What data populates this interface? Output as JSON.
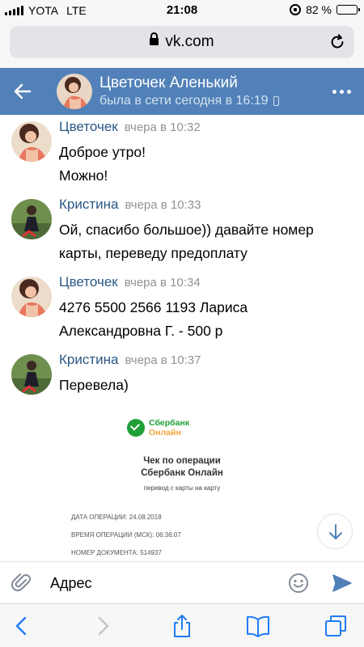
{
  "status_bar": {
    "carrier": "YOTA",
    "network": "LTE",
    "time": "21:08",
    "battery_percent": "82 %",
    "battery_level": 0.82
  },
  "browser": {
    "url": "vk.com"
  },
  "header": {
    "name": "Цветочек Аленький",
    "status": "была в сети сегодня в 16:19"
  },
  "messages": [
    {
      "author": "Цветочек",
      "time": "вчера в 10:32",
      "lines": [
        "Доброе утро!",
        "Можно!"
      ]
    },
    {
      "author": "Кристина",
      "time": "вчера в 10:33",
      "lines": [
        "Ой, спасибо большое)) давайте номер",
        "карты, переведу предоплату"
      ]
    },
    {
      "author": "Цветочек",
      "time": "вчера в 10:34",
      "lines": [
        "4276 5500 2566 1193 Лариса",
        "Александровна Г. - 500 р"
      ]
    },
    {
      "author": "Кристина",
      "time": "вчера в 10:37",
      "lines": [
        "Перевела)"
      ]
    }
  ],
  "receipt": {
    "logo_line1": "Сбербанк",
    "logo_line2": "Онлайн",
    "title_line1": "Чек по операции",
    "title_line2": "Сбербанк Онлайн",
    "subtitle": "перевод с карты на карту",
    "rows": [
      "ДАТА ОПЕРАЦИИ: 24.08.2018",
      "ВРЕМЯ ОПЕРАЦИИ (МСК): 06:36:07",
      "НОМЕР ДОКУМЕНТА: 514937"
    ]
  },
  "composer": {
    "placeholder": "Адрес"
  },
  "colors": {
    "vk_header": "#5181b8",
    "author_link": "#2a5885",
    "sber_green": "#21a038"
  }
}
